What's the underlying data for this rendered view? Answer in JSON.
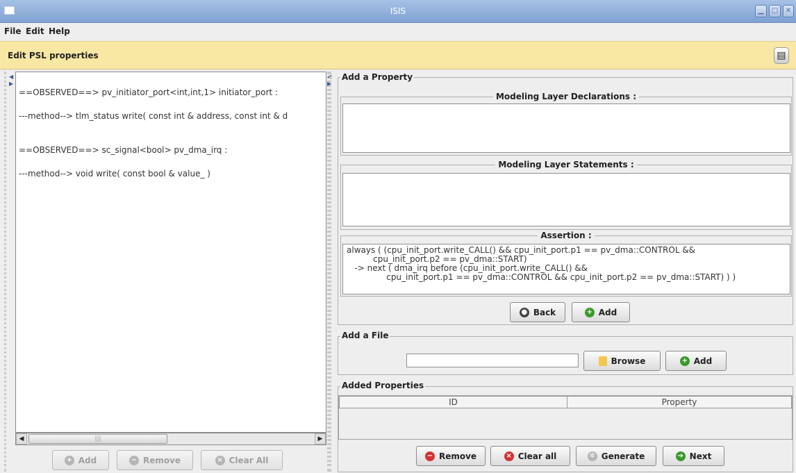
{
  "window": {
    "title": "ISIS"
  },
  "menu": [
    "File",
    "Edit",
    "Help"
  ],
  "header": {
    "title": "Edit PSL properties",
    "icon": "document-icon"
  },
  "left_panel": {
    "lines": [
      "==OBSERVED==> pv_initiator_port<int,int,1> initiator_port :",
      " ---method--> tlm_status write( const int & address, const int & d",
      "==OBSERVED==> sc_signal<bool> pv_dma_irq :",
      " ---method--> void write( const bool & value_ )"
    ],
    "buttons": {
      "add": "Add",
      "remove": "Remove",
      "clear_all": "Clear All"
    }
  },
  "add_property": {
    "legend": "Add a Property",
    "declarations_title": "Modeling Layer Declarations :",
    "declarations_value": "",
    "statements_title": "Modeling Layer Statements :",
    "statements_value": "",
    "assertion_title": "Assertion :",
    "assertion_value": "always ( (cpu_init_port.write_CALL() && cpu_init_port.p1 == pv_dma::CONTROL &&\n          cpu_init_port.p2 == pv_dma::START)\n   -> next ( dma_irq before (cpu_init_port.write_CALL() &&\n               cpu_init_port.p1 == pv_dma::CONTROL && cpu_init_port.p2 == pv_dma::START) ) )",
    "back_label": "Back",
    "add_label": "Add"
  },
  "add_file": {
    "legend": "Add a File",
    "path_value": "",
    "browse_label": "Browse",
    "add_label": "Add"
  },
  "added_properties": {
    "legend": "Added Properties",
    "columns": [
      "ID",
      "Property"
    ],
    "rows": []
  },
  "bottom_buttons": {
    "remove": "Remove",
    "clear_all": "Clear all",
    "generate": "Generate",
    "next": "Next"
  }
}
